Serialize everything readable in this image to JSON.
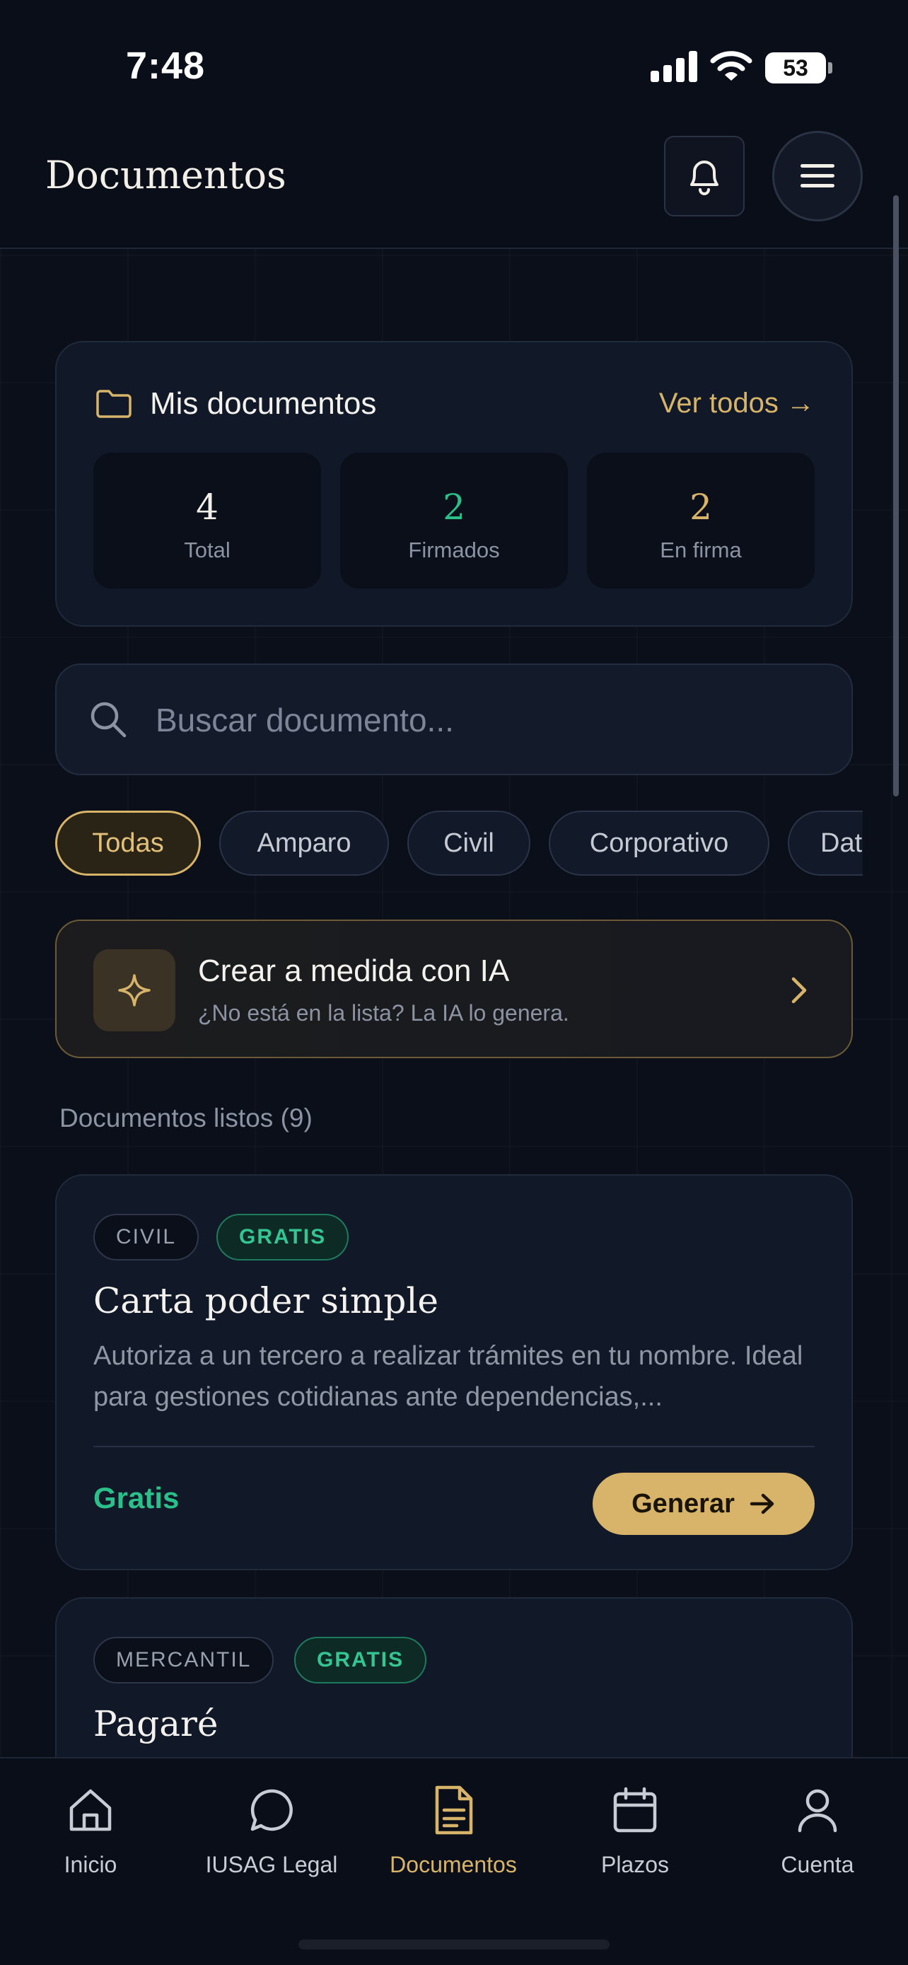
{
  "status_bar": {
    "time": "7:48",
    "battery": "53"
  },
  "header": {
    "title": "Documentos"
  },
  "summary": {
    "title": "Mis documentos",
    "see_all": "Ver todos →",
    "stats": [
      {
        "value": "4",
        "label": "Total",
        "color": "#f2efe8"
      },
      {
        "value": "2",
        "label": "Firmados",
        "color": "#2bbf8a"
      },
      {
        "value": "2",
        "label": "En firma",
        "color": "#d8b46a"
      }
    ]
  },
  "search": {
    "placeholder": "Buscar documento..."
  },
  "filters": [
    "Todas",
    "Amparo",
    "Civil",
    "Corporativo",
    "Datos"
  ],
  "ai_card": {
    "title": "Crear a medida con IA",
    "subtitle": "¿No está en la lista? La IA lo genera."
  },
  "section_label": "Documentos listos (9)",
  "documents": [
    {
      "category": "CIVIL",
      "badge": "GRATIS",
      "title": "Carta poder simple",
      "description": "Autoriza a un tercero a realizar trámites en tu nombre. Ideal para gestiones cotidianas ante dependencias,...",
      "price": "Gratis",
      "action": "Generar"
    },
    {
      "category": "MERCANTIL",
      "badge": "GRATIS",
      "title": "Pagaré"
    }
  ],
  "nav": [
    {
      "label": "Inicio",
      "icon": "home-icon"
    },
    {
      "label": "IUSAG Legal",
      "icon": "chat-bubble-icon"
    },
    {
      "label": "Documentos",
      "icon": "document-icon",
      "active": true
    },
    {
      "label": "Plazos",
      "icon": "calendar-icon"
    },
    {
      "label": "Cuenta",
      "icon": "user-icon"
    }
  ],
  "colors": {
    "accent_gold": "#d8b46a",
    "accent_green": "#2bbf8a",
    "background": "#0b0f19",
    "card": "#111827"
  }
}
